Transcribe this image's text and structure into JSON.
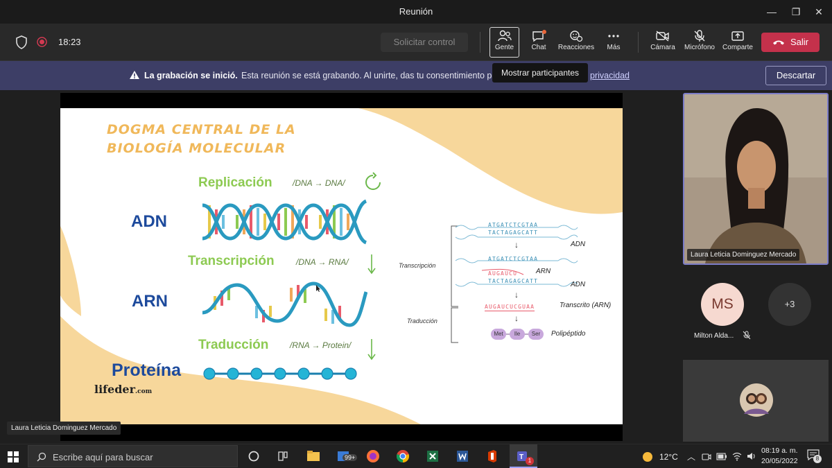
{
  "window": {
    "title": "Reunión",
    "minimize": "—",
    "maximize": "❐",
    "close": "✕"
  },
  "toolbar": {
    "timer": "18:23",
    "request_control": "Solicitar control",
    "people": "Gente",
    "chat": "Chat",
    "reactions": "Reacciones",
    "more": "Más",
    "camera": "Cámara",
    "mic": "Micrófono",
    "share": "Comparte",
    "leave": "Salir",
    "tooltip": "Mostrar participantes",
    "colors": {
      "leave": "#c4314b",
      "chat_dot": "#e8663a"
    }
  },
  "banner": {
    "title": "La grabación se inició.",
    "text": "Esta reunión se está grabando. Al unirte, das tu consentimiento par",
    "link": "privacidad",
    "dismiss": "Descartar"
  },
  "slide": {
    "heading_line1": "DOGMA CENTRAL DE LA",
    "heading_line2": "BIOLOGÍA MOLECULAR",
    "replicacion": "Replicación",
    "replicacion_note": "/DNA → DNA/",
    "adn": "ADN",
    "transcripcion": "Transcripción",
    "transcripcion_note": "/DNA → RNA/",
    "arn": "ARN",
    "traduccion": "Traducción",
    "traduccion_note": "/RNA → Protein/",
    "proteina": "Proteína",
    "logo": "lifeder",
    "logo_suffix": ".com",
    "diagram": {
      "seq_top": "ATGATCTCGTAA",
      "seq_bottom": "TACTAGAGCATT",
      "label_adn": "ADN",
      "label_transcripcion": "Transcripción",
      "seq_top2": "ATGATCTCGTAA",
      "seq_rna": "AUGAUCU",
      "label_arn": "ARN",
      "seq_bottom2": "TACTAGAGCATT",
      "label_adn2": "ADN",
      "seq_transcript": "AUGAUCUCGUAA",
      "label_transcrito": "Transcrito (ARN)",
      "label_traduccion": "Traducción",
      "aa1": "Met",
      "aa2": "Ile",
      "aa3": "Ser",
      "label_polipeptido": "Polipéptido"
    },
    "presenter_label": "Laura Leticia Dominguez Mercado"
  },
  "side": {
    "main_name": "Laura Leticia Dominguez Mercado",
    "ms_initials": "MS",
    "ms_name": "Milton Alda...",
    "more_count": "+3"
  },
  "taskbar": {
    "search_placeholder": "Escribe aquí para buscar",
    "badge_99": "99+",
    "temp": "12°C",
    "time": "08:19 a. m.",
    "date": "20/05/2022",
    "notif_count": "8",
    "teams_badge": "1"
  }
}
